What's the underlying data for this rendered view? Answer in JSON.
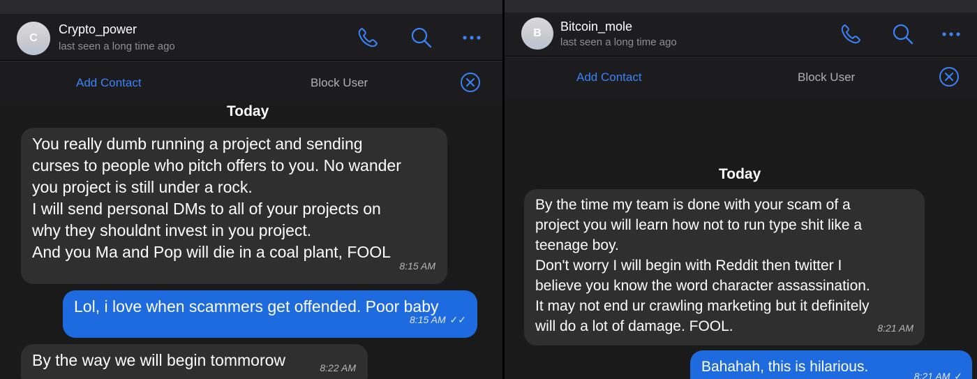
{
  "left_chat": {
    "contact": {
      "name": "Crypto_power",
      "initial": "C",
      "status": "last seen a long time ago"
    },
    "actions": {
      "add_contact": "Add Contact",
      "block_user": "Block User"
    },
    "date_divider": "Today",
    "messages": [
      {
        "direction": "in",
        "text": "You really dumb running a project and sending\ncurses to people who pitch offers to you. No wander\nyou project is still under a rock.\nI will send personal DMs to all of your projects on\nwhy they shouldnt invest in you project.\nAnd you Ma and Pop will die in a coal plant, FOOL",
        "time": "8:15 AM"
      },
      {
        "direction": "out",
        "text": "Lol, i love when scammers get offended. Poor baby",
        "time": "8:15 AM",
        "status": "✓✓"
      },
      {
        "direction": "in",
        "text": "By the way we will begin tommorow",
        "time": "8:22 AM"
      }
    ]
  },
  "right_chat": {
    "contact": {
      "name": "Bitcoin_mole",
      "initial": "B",
      "status": "last seen a long time ago"
    },
    "actions": {
      "add_contact": "Add Contact",
      "block_user": "Block User"
    },
    "date_divider": "Today",
    "messages": [
      {
        "direction": "in",
        "text": "By the time my team is done with your scam of a\nproject you will learn how not to run type shit like a\nteenage boy.\nDon't worry I will begin with Reddit then twitter I\nbelieve you know the word character assassination.\nIt may not end ur crawling marketing but it definitely\nwill do a lot of damage. FOOL.",
        "time": "8:21 AM"
      },
      {
        "direction": "out",
        "text": "Bahahah, this is hilarious.",
        "time": "8:21 AM",
        "status": "✓"
      }
    ]
  },
  "icons": {
    "call": "phone-icon",
    "search": "search-icon",
    "more": "more-icon",
    "close": "close-circle-icon"
  },
  "colors": {
    "accent": "#3a82f7",
    "outgoing_bubble": "#1e6adf",
    "incoming_bubble": "#2f2f30",
    "background": "#1a1a1a",
    "header": "#1d1d1f"
  }
}
